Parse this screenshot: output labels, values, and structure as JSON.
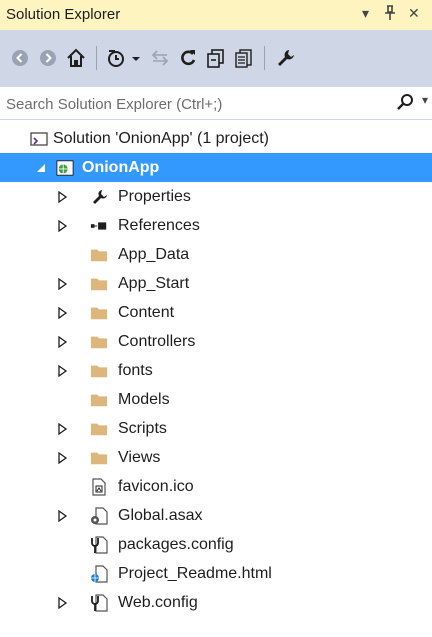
{
  "window": {
    "title": "Solution Explorer",
    "dropdown_glyph": "▾",
    "pin_glyph": "ᛒ",
    "close_glyph": "✕"
  },
  "search": {
    "placeholder": "Search Solution Explorer (Ctrl+;)"
  },
  "tree": {
    "solution_label": "Solution 'OnionApp' (1 project)",
    "items": [
      {
        "label": "OnionApp",
        "icon": "web-project-icon"
      },
      {
        "label": "Properties",
        "icon": "wrench-icon"
      },
      {
        "label": "References",
        "icon": "references-icon"
      },
      {
        "label": "App_Data",
        "icon": "folder-icon"
      },
      {
        "label": "App_Start",
        "icon": "folder-icon"
      },
      {
        "label": "Content",
        "icon": "folder-icon"
      },
      {
        "label": "Controllers",
        "icon": "folder-icon"
      },
      {
        "label": "fonts",
        "icon": "folder-icon"
      },
      {
        "label": "Models",
        "icon": "folder-icon"
      },
      {
        "label": "Scripts",
        "icon": "folder-icon"
      },
      {
        "label": "Views",
        "icon": "folder-icon"
      },
      {
        "label": "favicon.ico",
        "icon": "image-file-icon"
      },
      {
        "label": "Global.asax",
        "icon": "global-asax-icon"
      },
      {
        "label": "packages.config",
        "icon": "config-file-icon"
      },
      {
        "label": "Project_Readme.html",
        "icon": "html-file-icon"
      },
      {
        "label": "Web.config",
        "icon": "config-file-icon"
      }
    ]
  },
  "colors": {
    "title_bg": "#fdf4bf",
    "toolbar_bg": "#cfd6e5",
    "selection": "#3399ff",
    "folder": "#dcb67a"
  }
}
